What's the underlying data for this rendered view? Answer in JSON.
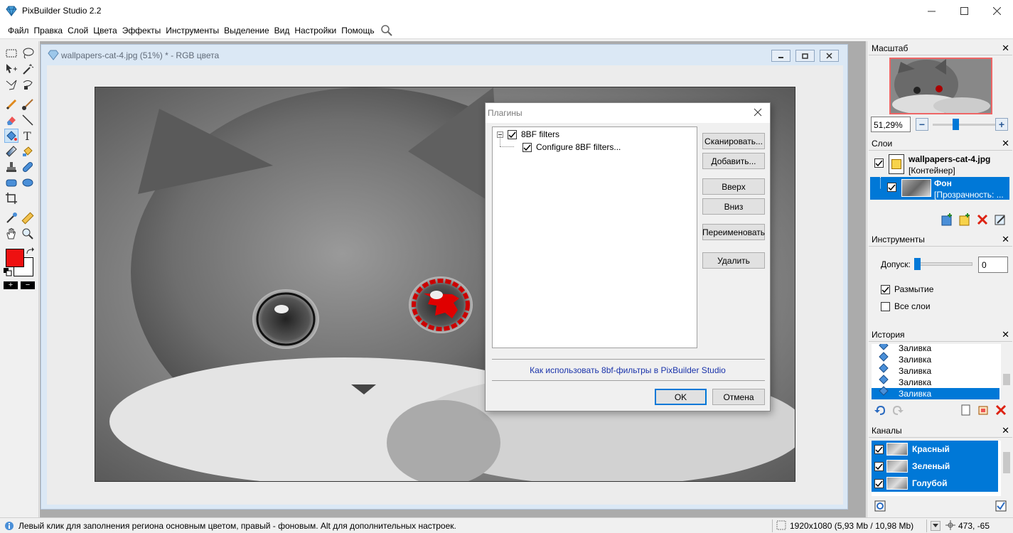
{
  "app": {
    "title": "PixBuilder Studio 2.2",
    "menu": [
      "Файл",
      "Правка",
      "Слой",
      "Цвета",
      "Эффекты",
      "Инструменты",
      "Выделение",
      "Вид",
      "Настройки",
      "Помощь"
    ]
  },
  "document": {
    "title": "wallpapers-cat-4.jpg (51%) * - RGB цвета"
  },
  "toolbox": {
    "foreground_color": "#ee1111",
    "background_color": "#ffffff"
  },
  "dialog": {
    "title": "Плагины",
    "tree": [
      {
        "label": "8BF filters",
        "checked": true
      },
      {
        "label": "Configure 8BF filters...",
        "checked": true
      }
    ],
    "buttons": {
      "scan": "Сканировать...",
      "add": "Добавить...",
      "up": "Вверх",
      "down": "Вниз",
      "rename": "Переименовать",
      "delete": "Удалить"
    },
    "link": "Как использовать 8bf-фильтры в PixBuilder Studio",
    "ok": "OK",
    "cancel": "Отмена"
  },
  "panels": {
    "zoom": {
      "title": "Масштаб",
      "value": "51,29%"
    },
    "layers": {
      "title": "Слои",
      "items": [
        {
          "name": "wallpapers-cat-4.jpg",
          "sub": "[Контейнер]"
        },
        {
          "name": "Фон",
          "sub": "[Прозрачность: ..."
        }
      ]
    },
    "tools": {
      "title": "Инструменты",
      "tolerance_label": "Допуск:",
      "tolerance_value": "0",
      "blur_label": "Размытие",
      "all_layers_label": "Все слои"
    },
    "history": {
      "title": "История",
      "items": [
        "Заливка",
        "Заливка",
        "Заливка",
        "Заливка",
        "Заливка"
      ]
    },
    "channels": {
      "title": "Каналы",
      "items": [
        "Красный",
        "Зеленый",
        "Голубой"
      ]
    }
  },
  "status": {
    "hint": "Левый клик для заполнения региона основным цветом, правый - фоновым. Alt для дополнительных настроек.",
    "size": "1920x1080  (5,93 Mb / 10,98 Mb)",
    "coords": "473, -65"
  }
}
